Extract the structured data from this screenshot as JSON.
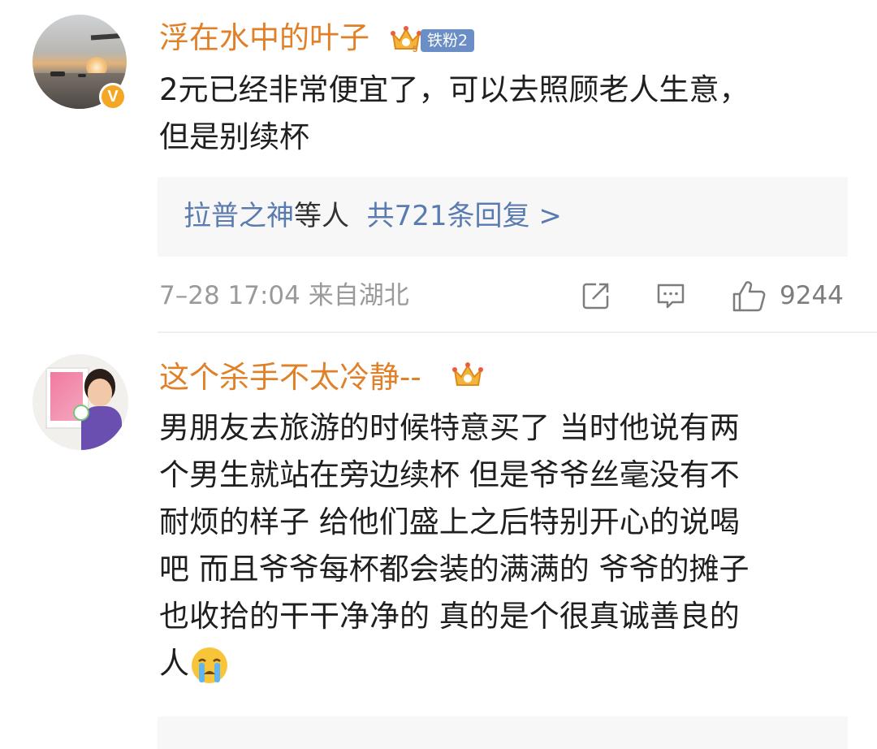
{
  "comments": [
    {
      "username": "浮在水中的叶子",
      "fan_badge": "铁粉2",
      "crown_level": "5",
      "verified_badge": "V",
      "text": "2元已经非常便宜了，可以去照顾老人生意，\n但是别续杯",
      "replies": {
        "users": "拉普之神",
        "suffix": "等人",
        "count_text": "共721条回复 >"
      },
      "meta": "7–28 17:04 来自湖北",
      "like_count": "9244",
      "icons": [
        "share-icon",
        "comment-icon",
        "like-icon"
      ]
    },
    {
      "username": "这个杀手不太冷静--",
      "crown_level": "",
      "text": "男朋友去旅游的时候特意买了 当时他说有两\n个男生就站在旁边续杯 但是爷爷丝毫没有不\n耐烦的样子 给他们盛上之后特别开心的说喝\n吧 而且爷爷每杯都会装的满满的 爷爷的摊子\n也收拾的干干净净的 真的是个很真诚善良的\n人",
      "emoji": "crying-face-emoji"
    }
  ],
  "colors": {
    "username": "#e0812a",
    "link": "#5a7bb0",
    "meta": "#9a9a9a",
    "body_text": "#1f1f1f",
    "reply_bg": "#f7f7f7",
    "fan_badge_bg": "#6b8ec7",
    "verified": "#f5a623"
  }
}
